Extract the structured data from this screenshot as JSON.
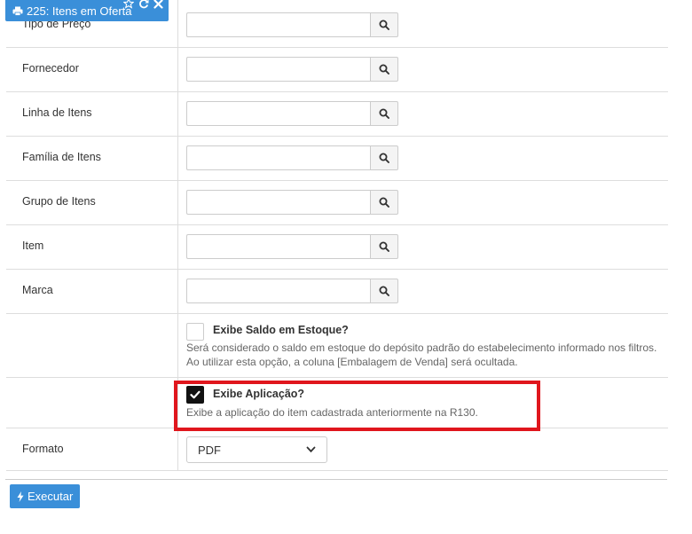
{
  "tab": {
    "title": "225: Itens em Oferta",
    "print_icon": "print-icon",
    "star_icon": "star-icon",
    "refresh_icon": "refresh-icon",
    "close_icon": "close-icon"
  },
  "fields": [
    {
      "label": "Tipo de Preço",
      "value": ""
    },
    {
      "label": "Fornecedor",
      "value": ""
    },
    {
      "label": "Linha de Itens",
      "value": ""
    },
    {
      "label": "Família de Itens",
      "value": ""
    },
    {
      "label": "Grupo de Itens",
      "value": ""
    },
    {
      "label": "Item",
      "value": ""
    },
    {
      "label": "Marca",
      "value": ""
    }
  ],
  "saldo": {
    "title": "Exibe Saldo em Estoque?",
    "checked": false,
    "help_line1": "Será considerado o saldo em estoque do depósito padrão do estabelecimento informado nos filtros.",
    "help_line2": "Ao utilizar esta opção, a coluna [Embalagem de Venda] será ocultada."
  },
  "aplicacao": {
    "title": "Exibe Aplicação?",
    "checked": true,
    "help": "Exibe a aplicação do item cadastrada anteriormente na R130."
  },
  "formato": {
    "label": "Formato",
    "selected": "PDF"
  },
  "execute_label": "Executar",
  "colors": {
    "accent": "#3a8fd9",
    "highlight": "#e0161d"
  }
}
